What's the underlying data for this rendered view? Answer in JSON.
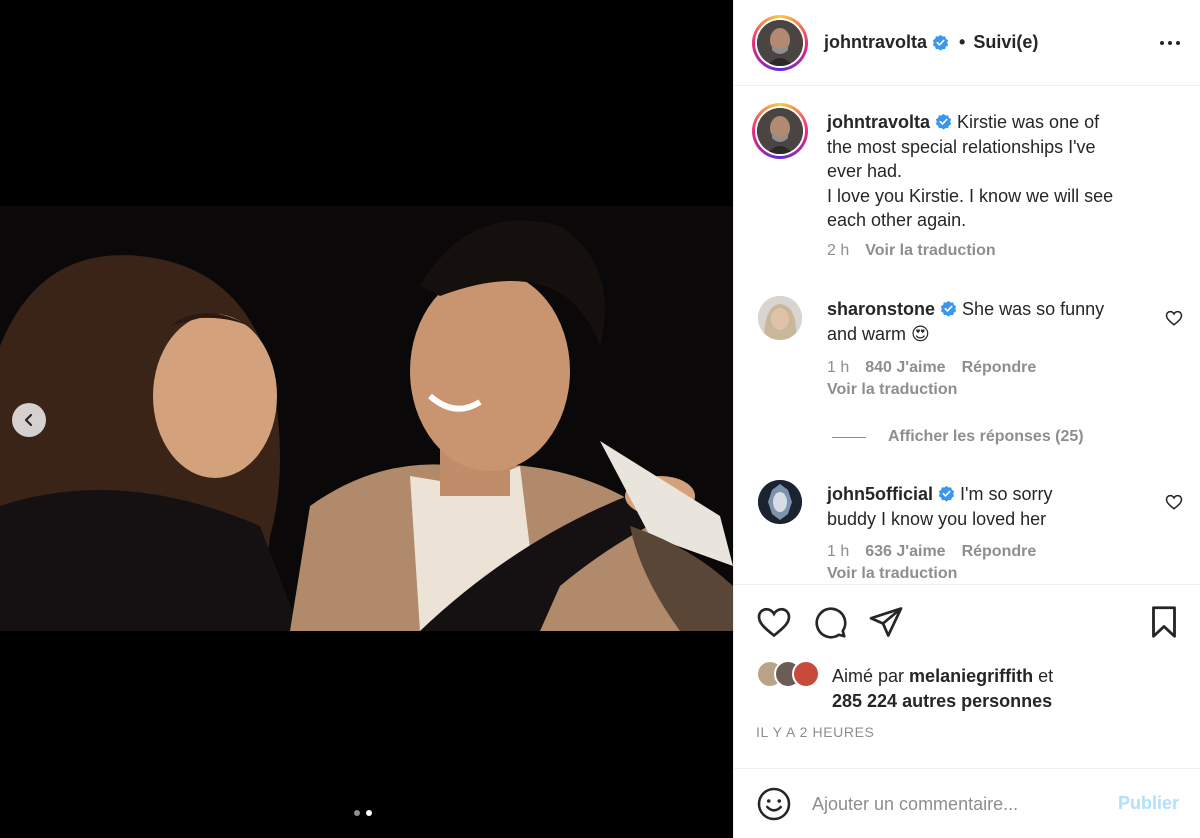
{
  "post": {
    "author": "johntravolta",
    "follow_label": "Suivi(e)",
    "separator": "•",
    "caption_lines": [
      "Kirstie was one of",
      "the most special relationships I've",
      "ever had.",
      "I love you Kirstie. I know we will see",
      "each other again."
    ],
    "caption_time": "2 h",
    "translate_label": "Voir la traduction"
  },
  "comments": [
    {
      "user": "sharonstone",
      "text_lines": [
        "She was so funny",
        "and warm 😍"
      ],
      "time": "1 h",
      "likes": "840 J'aime",
      "reply_label": "Répondre",
      "translate_label": "Voir la traduction"
    },
    {
      "user": "john5official",
      "text_lines": [
        "I'm so sorry",
        "buddy I know you loved her"
      ],
      "time": "1 h",
      "likes": "636 J'aime",
      "reply_label": "Répondre",
      "translate_label": "Voir la traduction"
    }
  ],
  "view_replies_label": "Afficher les réponses (25)",
  "likes_summary": {
    "prefix": "Aimé par",
    "user": "melaniegriffith",
    "connector": "et",
    "others": "285 224 autres personnes"
  },
  "time_ago": "IL Y A 2 HEURES",
  "composer": {
    "placeholder": "Ajouter un commentaire...",
    "publish_label": "Publier"
  },
  "carousel": {
    "current": 2,
    "total": 2
  },
  "colors": {
    "verified": "#3897f0",
    "publish_disabled": "#b2dffc",
    "muted": "#8e8e8e"
  },
  "icons": [
    "chevron-left-icon",
    "verified-badge-icon",
    "more-options-icon",
    "heart-icon",
    "comment-icon",
    "share-icon",
    "save-icon",
    "emoji-icon"
  ]
}
